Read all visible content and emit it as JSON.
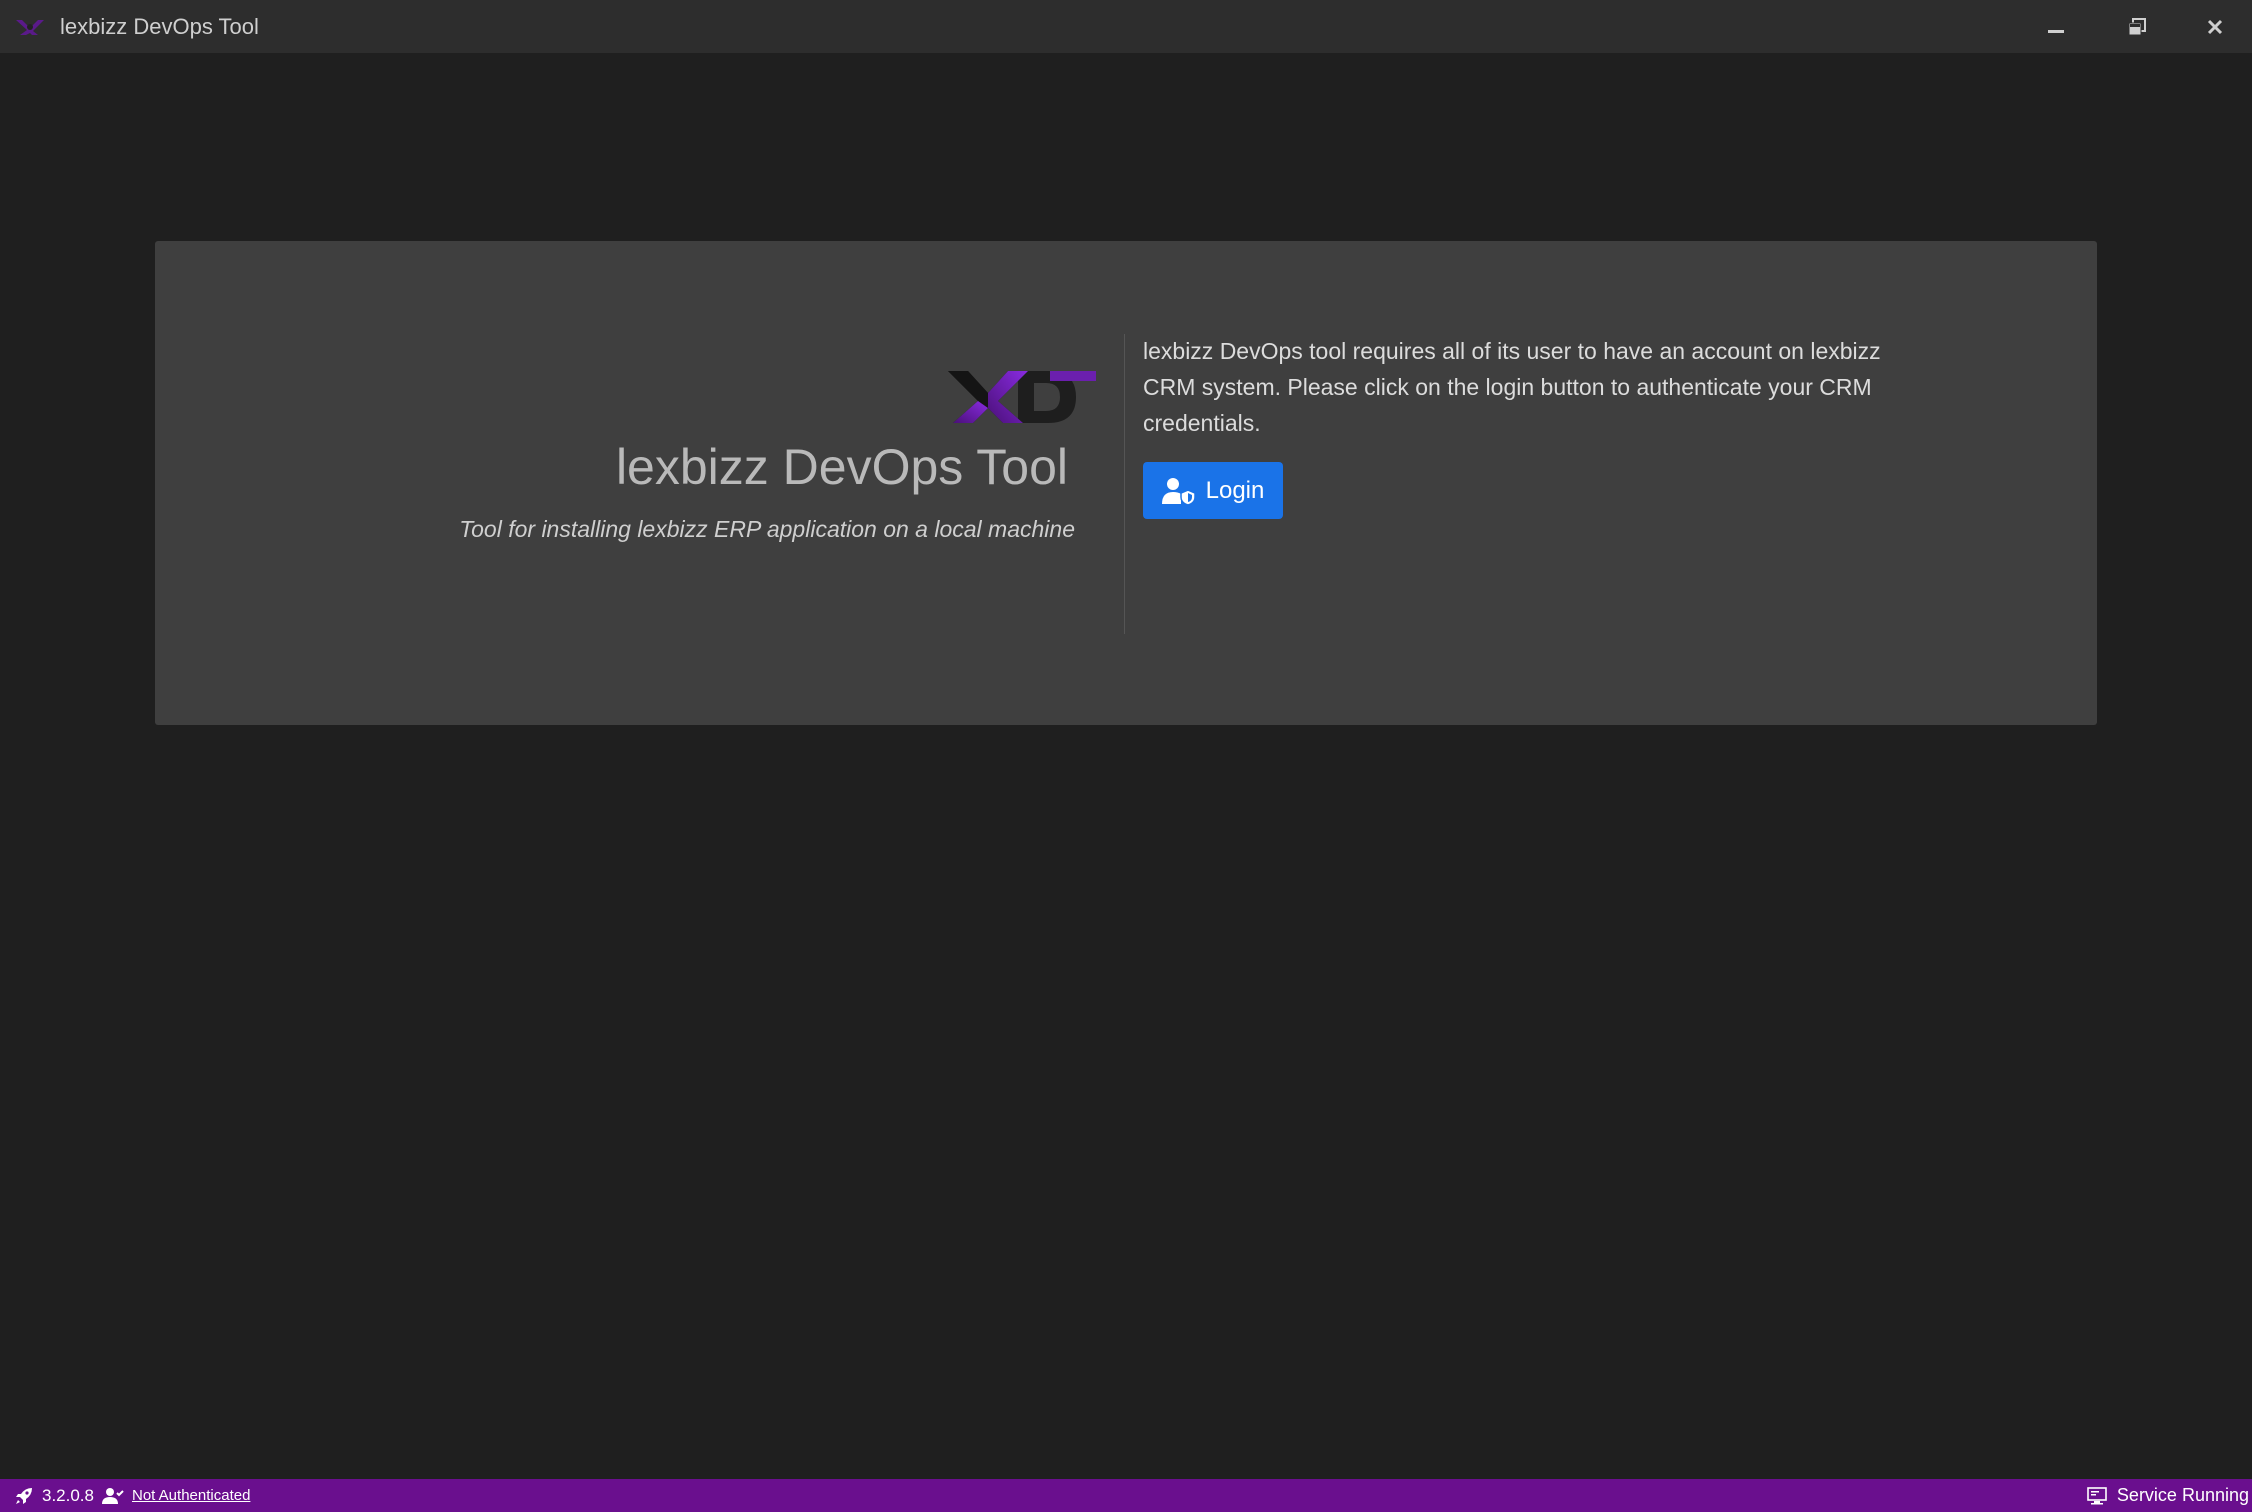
{
  "window": {
    "title": "lexbizz DevOps Tool",
    "icons": {
      "app": "xdt-logo-icon",
      "minimize": "minimize-icon",
      "restore": "restore-icon",
      "close": "close-icon"
    }
  },
  "hero": {
    "logo_text": "XDT",
    "title": "lexbizz DevOps Tool",
    "subtitle": "Tool for installing lexbizz ERP application on a local machine"
  },
  "auth": {
    "message": "lexbizz DevOps tool requires all of its user to have an account on lexbizz CRM system. Please click on the login button to authenticate your CRM credentials.",
    "login_label": "Login",
    "login_icon": "user-shield-icon"
  },
  "statusbar": {
    "version_icon": "rocket-icon",
    "version": "3.2.0.8",
    "auth_icon": "user-icon",
    "auth_status": "Not Authenticated",
    "service_icon": "monitor-icon",
    "service_status": "Service Running"
  },
  "colors": {
    "accent": "#1a73e8",
    "statusbar": "#6a0f8e",
    "logo_purple": "#6b1fae",
    "background": "#1f1f1f",
    "card": "#3f3f3f"
  }
}
